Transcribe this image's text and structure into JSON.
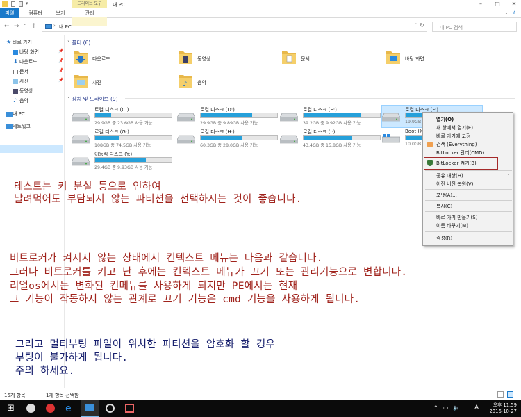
{
  "ribbon": {
    "tabs": [
      "파일",
      "컴퓨터",
      "보기",
      "관리"
    ],
    "context_tab": "드라이브 도구",
    "window_title": "내 PC"
  },
  "address": {
    "path": "내 PC",
    "search_placeholder": "내 PC 검색"
  },
  "nav": {
    "quick_access": "바로 가기",
    "items": [
      "바탕 화면",
      "다운로드",
      "문서",
      "사진",
      "동영상",
      "음악"
    ],
    "this_pc": "내 PC",
    "network": "네트워크"
  },
  "folders_group": "폴더 (6)",
  "folders": [
    "다운로드",
    "동영상",
    "문서",
    "바탕 화면",
    "사진",
    "음악"
  ],
  "drives_group": "장치 및 드라이브 (9)",
  "drives": [
    {
      "name": "로컬 디스크 (C:)",
      "free": "29.9GB 중 23.6GB 사용 가능",
      "used": 0.21
    },
    {
      "name": "로컬 디스크 (D:)",
      "free": "29.9GB 중 9.89GB 사용 가능",
      "used": 0.67
    },
    {
      "name": "로컬 디스크 (E:)",
      "free": "39.2GB 중 9.92GB 사용 가능",
      "used": 0.75
    },
    {
      "name": "로컬 디스크 (F:)",
      "free": "19.9GB",
      "used": 0.3
    },
    {
      "name": "로컬 디스크 (G:)",
      "free": "108GB 중 74.5GB 사용 가능",
      "used": 0.31
    },
    {
      "name": "로컬 디스크 (H:)",
      "free": "60.3GB 중 28.0GB 사용 가능",
      "used": 0.54
    },
    {
      "name": "로컬 디스크 (I:)",
      "free": "43.4GB 중 15.8GB 사용 가능",
      "used": 0.64
    },
    {
      "name": "Boot (X:)",
      "free": "10.0GB",
      "used": 0.6
    },
    {
      "name": "이동식 디스크 (Y:)",
      "free": "29.4GB 중 9.93GB 사용 가능",
      "used": 0.66
    }
  ],
  "context_menu": {
    "items": [
      "열기(O)",
      "새 창에서 열기(E)",
      "바로 가기에 고정",
      "검색 (Everything)",
      "BitLocker 관리(CMD)",
      "BitLocker 켜기(B)",
      "공유 대상(H)",
      "이전 버전 복원(V)",
      "포맷(A)...",
      "복사(C)",
      "바로 가기 만들기(S)",
      "이름 바꾸기(M)",
      "속성(R)"
    ]
  },
  "notes": {
    "red1": [
      "테스트는 키 분실 등으로 인하여",
      "날려먹어도 부담되지 않는 파티션을 선택하시는 것이 좋습니다."
    ],
    "red2": [
      "비트로커가 켜지지 않는 상태에서 컨텍스트 메뉴는 다음과 같습니다.",
      "그러나 비트로커를 키고 난 후에는 컨텍스트 메뉴가 끄기 또는 관리기능으로 변합니다.",
      "리얼os에서는 변화된 컨메뉴를 사용하게 되지만 PE에서는 현재",
      "그 기능이 작동하지 않는 관계로 끄기 기능은 cmd 기능을 사용하게 됩니다."
    ],
    "navy": [
      "그리고 멀티부팅 파일이 위치한 파티션을 암호화 할 경우",
      "부팅이 불가하게 됩니다.",
      "주의 하세요."
    ]
  },
  "status": {
    "count": "15개 항목",
    "selected": "1개 항목 선택함"
  },
  "taskbar": {
    "time": "오후 11:59",
    "date": "2016-10-27",
    "lang": "A"
  }
}
